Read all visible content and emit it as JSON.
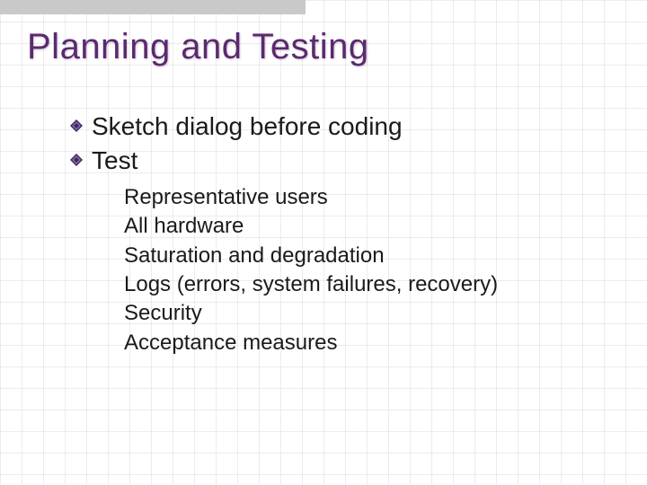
{
  "title": "Planning and Testing",
  "bullet1": "Sketch dialog before coding",
  "bullet2": "Test",
  "sub": {
    "a": "Representative users",
    "b": "All hardware",
    "c": "Saturation and degradation",
    "d": "Logs (errors, system failures, recovery)",
    "e": "Security",
    "f": "Acceptance measures"
  },
  "colors": {
    "title": "#5a2a6e",
    "bullet_icon_dark": "#3a2a5e",
    "bullet_icon_light": "#8a6ab0"
  }
}
